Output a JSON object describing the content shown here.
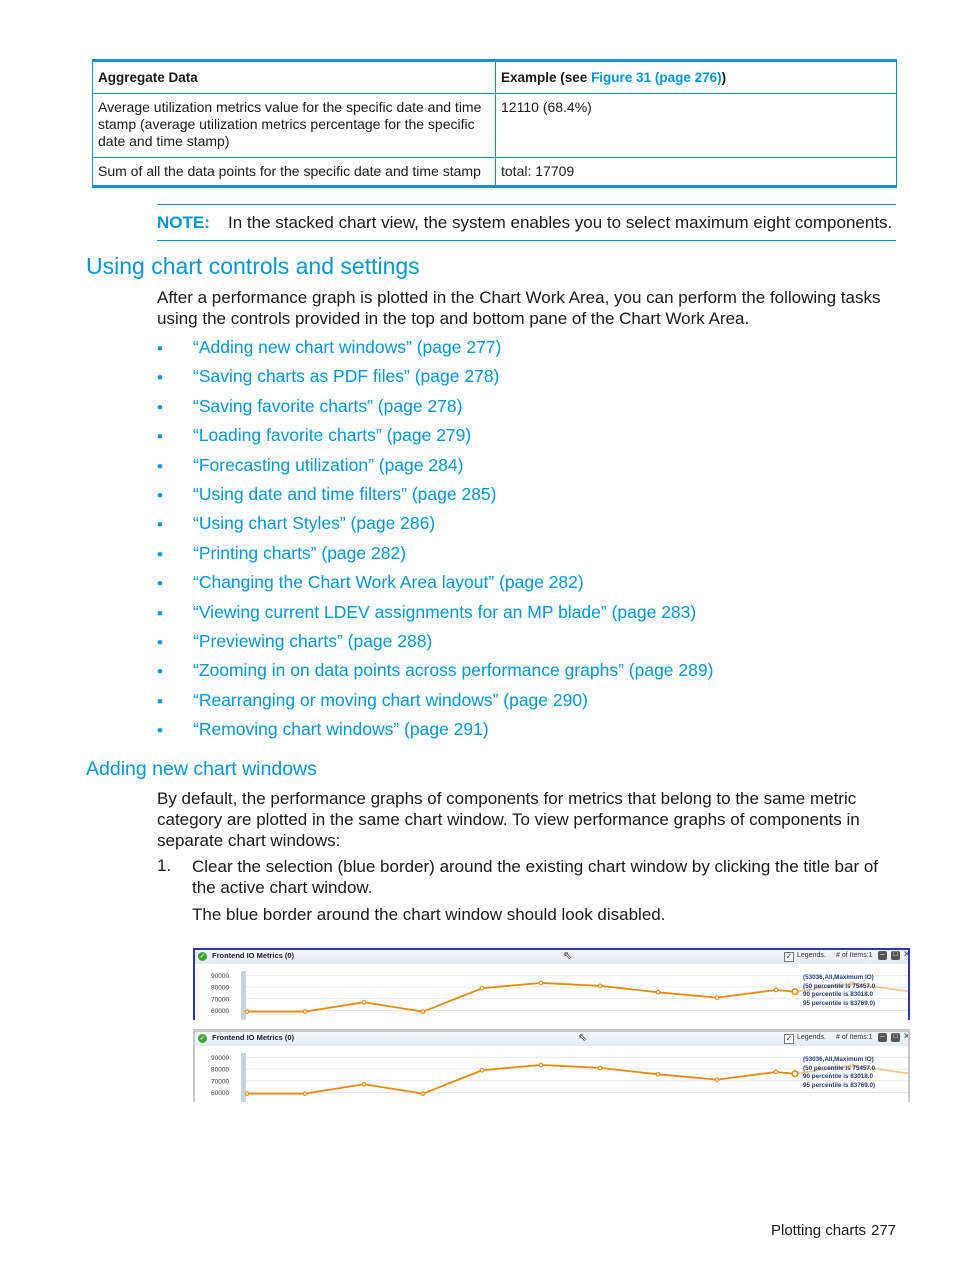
{
  "table": {
    "headers": {
      "col1": "Aggregate Data",
      "col2_prefix": "Example (see ",
      "col2_link": "Figure 31 (page 276)",
      "col2_suffix": ")"
    },
    "rows": [
      {
        "description": "Average utilization metrics value for the specific date and time stamp (average utilization metrics percentage for the specific date and time stamp)",
        "example": "12110 (68.4%)"
      },
      {
        "description": "Sum of all the data points for the specific date and time stamp",
        "example": "total: 17709"
      }
    ]
  },
  "note": {
    "label": "NOTE:",
    "text": "In the stacked chart view, the system enables you to select maximum eight components."
  },
  "section1": {
    "heading": "Using chart controls and settings",
    "intro_line1": "After a performance graph is plotted in the Chart Work Area, you can perform the following tasks",
    "intro_line2": "using the controls provided in the top and bottom pane of the Chart Work Area.",
    "bullet": "•",
    "links": [
      "“Adding new chart windows” (page 277)",
      "“Saving charts as PDF files” (page 278)",
      "“Saving favorite charts” (page 278)",
      "“Loading favorite charts” (page 279)",
      "“Forecasting utilization” (page 284)",
      "“Using date and time filters” (page 285)",
      "“Using chart Styles” (page 286)",
      "“Printing charts” (page 282)",
      "“Changing the Chart Work Area layout” (page 282)",
      "“Viewing current LDEV assignments for an MP blade” (page 283)",
      "“Previewing charts” (page 288)",
      "“Zooming in on data points across performance graphs” (page 289)",
      "“Rearranging or moving chart windows” (page 290)",
      "“Removing chart windows” (page 291)"
    ]
  },
  "section2": {
    "heading": "Adding new chart windows",
    "para_line1": "By default, the performance graphs of components for metrics that belong to the same metric",
    "para_line2": "category are plotted in the same chart window. To view performance graphs of components in",
    "para_line3": "separate chart windows:",
    "step1_num": "1.",
    "step1_line1": "Clear the selection (blue border) around the existing chart window by clicking the title bar of",
    "step1_line2": "the active chart window.",
    "step1_result": "The blue border around the chart window should look disabled."
  },
  "chart_windows": [
    {
      "state": "selected",
      "title": "Frontend IO Metrics (0)",
      "legends_label": "Legends.",
      "legends_checked": true,
      "items_label": "# of Items:1",
      "percentiles": [
        "(53036,All,Maximum IO)",
        "(50 percentile is 75457.0",
        "90 percentile is 83018.0",
        "95 percentile is 83769.0)"
      ]
    },
    {
      "state": "deselected",
      "title": "Frontend IO Metrics (0)",
      "legends_label": "Legends.",
      "legends_checked": true,
      "items_label": "# of Items:1",
      "percentiles": [
        "(53036,All,Maximum IO)",
        "(50 percentile is 75457.0",
        "90 percentile is 83018.0",
        "95 percentile is 83769.0)"
      ]
    }
  ],
  "chart_data": {
    "type": "line",
    "title": "Frontend IO Metrics (0)",
    "ylabel": "",
    "xlabel": "",
    "y_ticks": [
      90000,
      80000,
      70000,
      60000
    ],
    "ylim": [
      57000,
      92000
    ],
    "series": [
      {
        "name": "53036,All,Maximum IO",
        "color": "#e8890c",
        "values": [
          59000,
          59000,
          67000,
          59000,
          79000,
          83500,
          81000,
          75500,
          71000,
          77500,
          76000,
          83000,
          76000
        ]
      }
    ],
    "highlighted_point_index": 10,
    "faded_from_index": 10
  },
  "footer": {
    "section": "Plotting charts",
    "page": "277"
  },
  "colors": {
    "accent": "#0096d6",
    "table_border": "#1a8fd0",
    "selected_border": "#2a36c8",
    "series": "#e8890c"
  }
}
